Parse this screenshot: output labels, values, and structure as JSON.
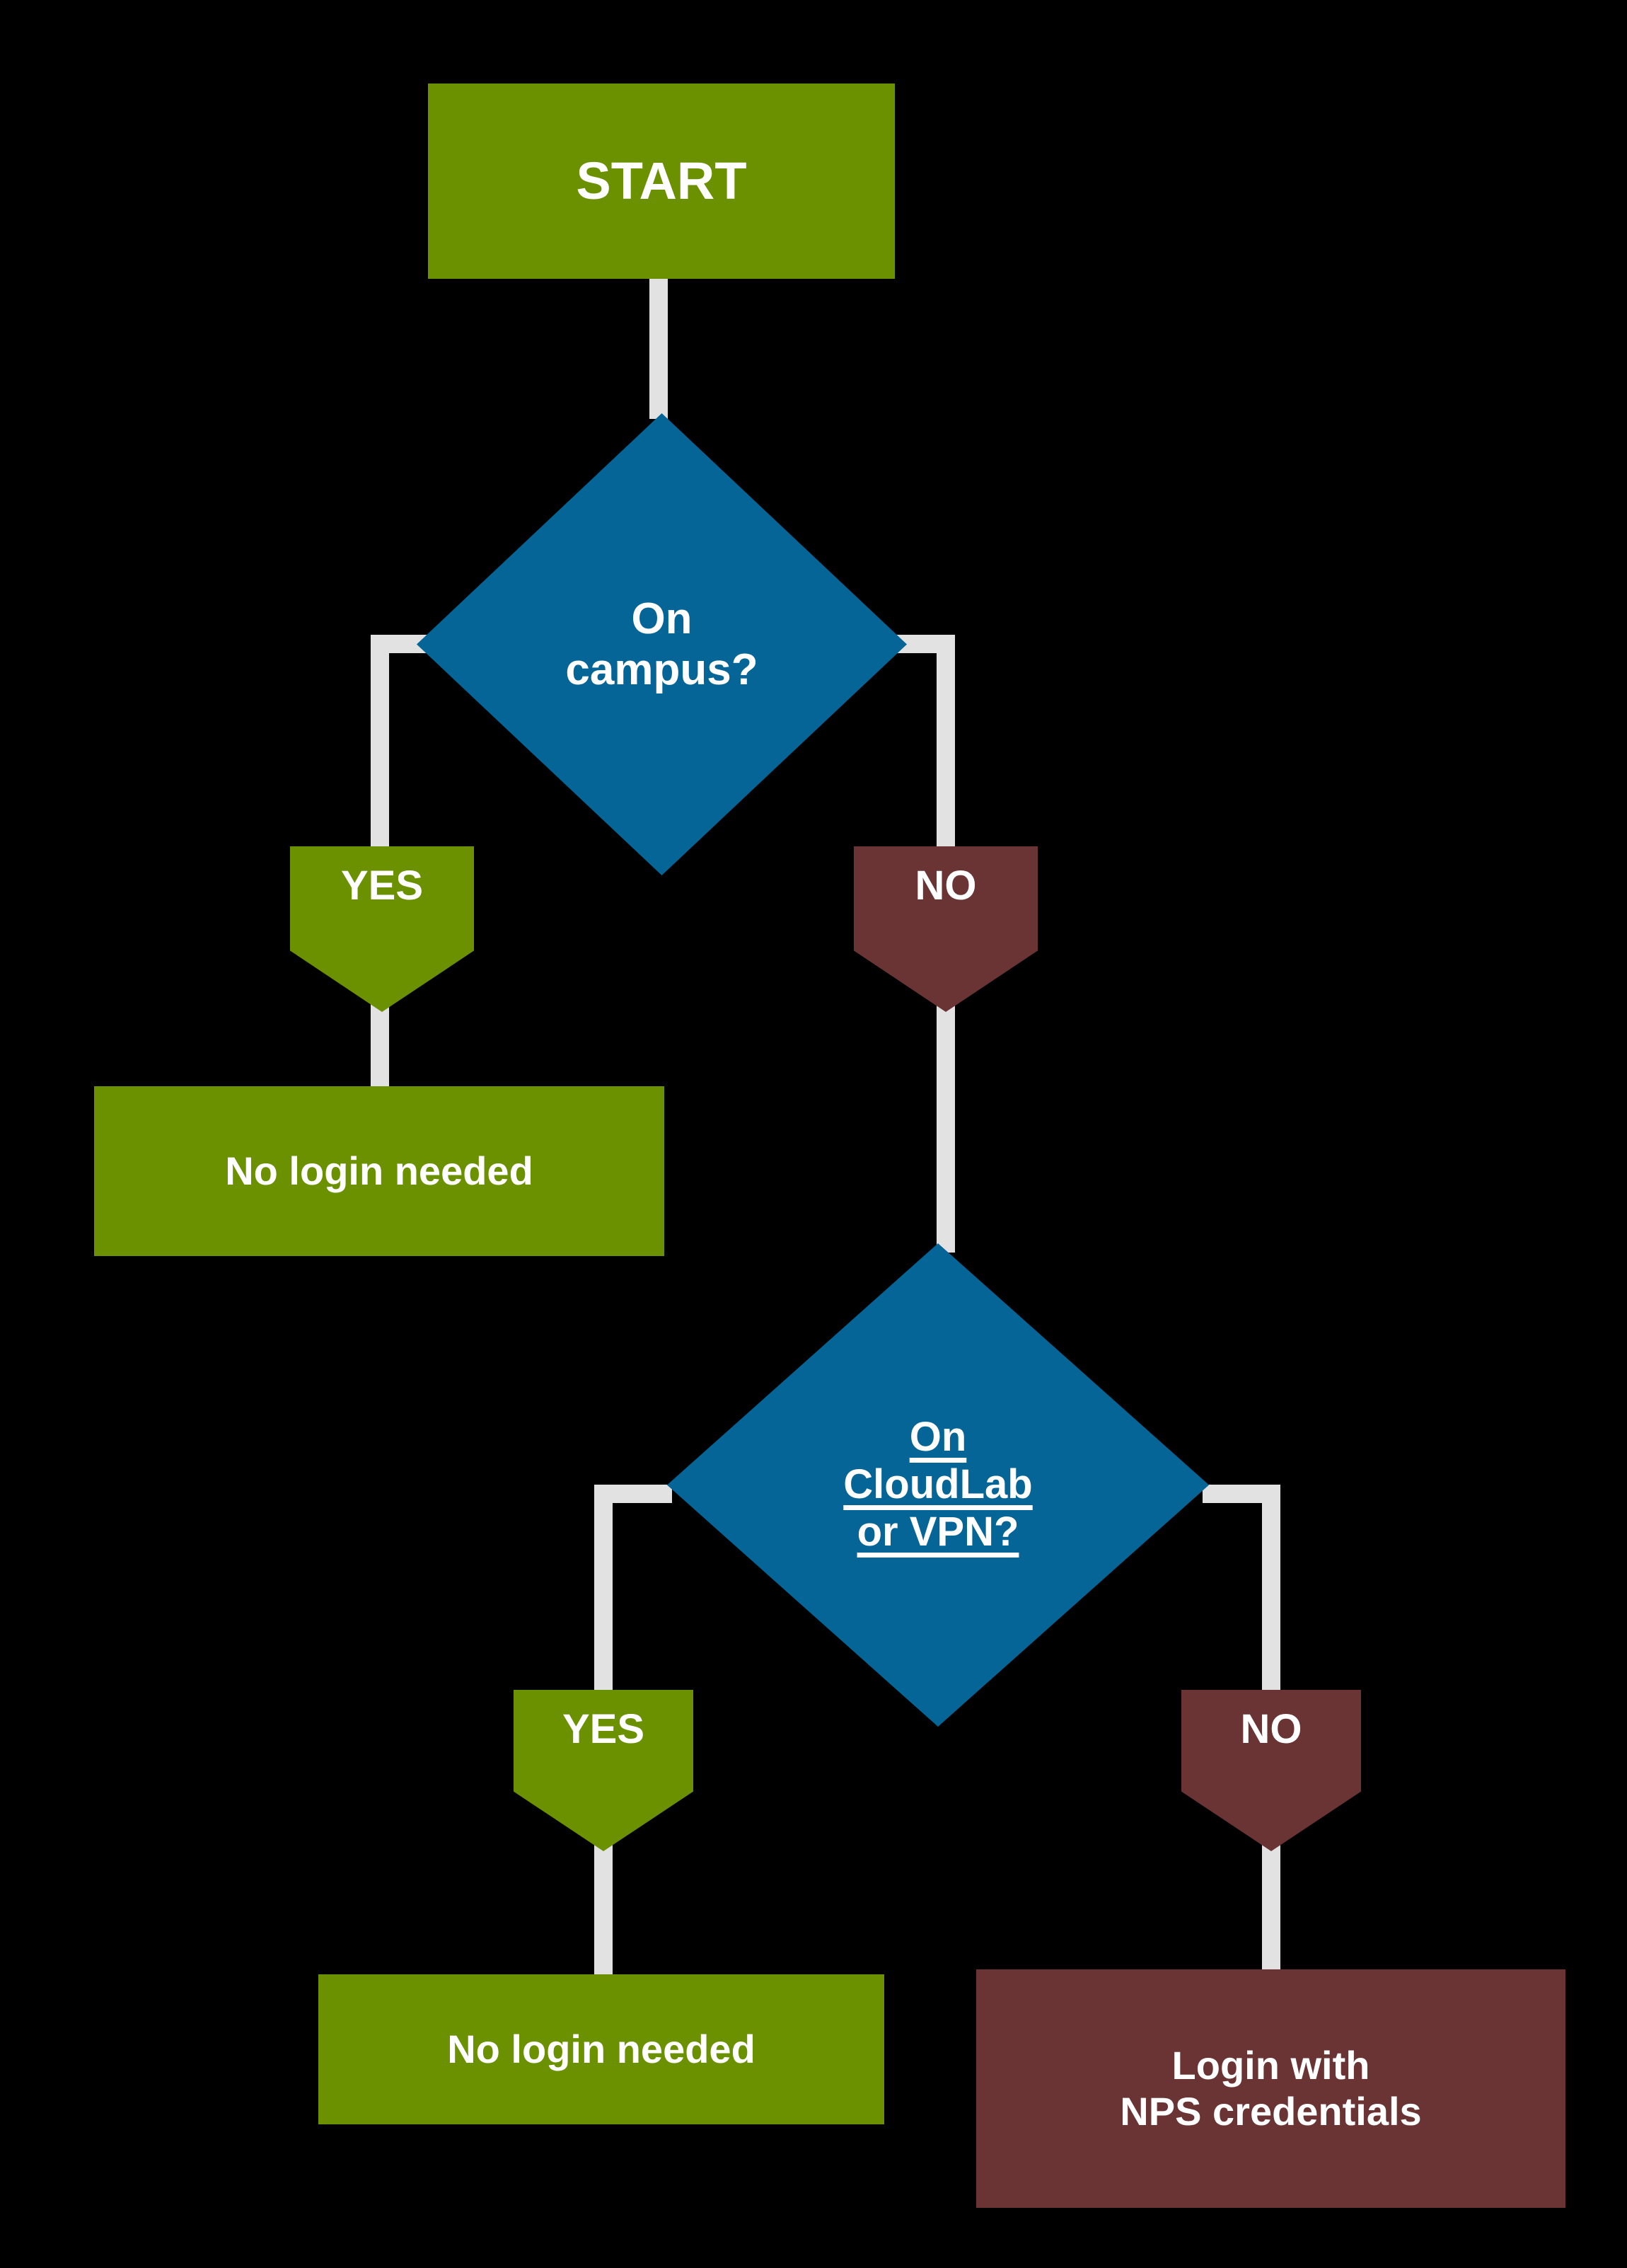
{
  "diagram": {
    "title": "Campus network login decision flowchart",
    "background_color": "#000000",
    "colors": {
      "green": "#6b9100",
      "blue": "#056596",
      "maroon": "#6b3434",
      "connector": "#e2e2e2",
      "text": "#ffffff"
    },
    "nodes": {
      "start": {
        "label": "START",
        "shape": "rectangle",
        "color": "#6b9100"
      },
      "decision_campus": {
        "label": "On\ncampus?",
        "line1": "On",
        "line2": "campus?",
        "shape": "diamond",
        "color": "#056596"
      },
      "yes_1": {
        "label": "YES",
        "shape": "pentagon",
        "color": "#6b9100"
      },
      "no_1": {
        "label": "NO",
        "shape": "pentagon",
        "color": "#6b3434"
      },
      "result_no_login_1": {
        "label": "No login needed",
        "shape": "rectangle",
        "color": "#6b9100"
      },
      "decision_cloudlab": {
        "label": "On CloudLab or VPN?",
        "line1": "On",
        "line2": "CloudLab",
        "line3": "or VPN?",
        "shape": "diamond",
        "color": "#056596",
        "underlined": true
      },
      "yes_2": {
        "label": "YES",
        "shape": "pentagon",
        "color": "#6b9100"
      },
      "no_2": {
        "label": "NO",
        "shape": "pentagon",
        "color": "#6b3434"
      },
      "result_no_login_2": {
        "label": "No login needed",
        "shape": "rectangle",
        "color": "#6b9100"
      },
      "result_login": {
        "label": "Login with NPS credentials",
        "line1": "Login with",
        "line2": "NPS credentials",
        "shape": "rectangle",
        "color": "#6b3434"
      }
    },
    "edges": [
      {
        "from": "start",
        "to": "decision_campus",
        "label": ""
      },
      {
        "from": "decision_campus",
        "to": "yes_1",
        "label": "YES"
      },
      {
        "from": "decision_campus",
        "to": "no_1",
        "label": "NO"
      },
      {
        "from": "yes_1",
        "to": "result_no_login_1",
        "label": ""
      },
      {
        "from": "no_1",
        "to": "decision_cloudlab",
        "label": ""
      },
      {
        "from": "decision_cloudlab",
        "to": "yes_2",
        "label": "YES"
      },
      {
        "from": "decision_cloudlab",
        "to": "no_2",
        "label": "NO"
      },
      {
        "from": "yes_2",
        "to": "result_no_login_2",
        "label": ""
      },
      {
        "from": "no_2",
        "to": "result_login",
        "label": ""
      }
    ]
  }
}
